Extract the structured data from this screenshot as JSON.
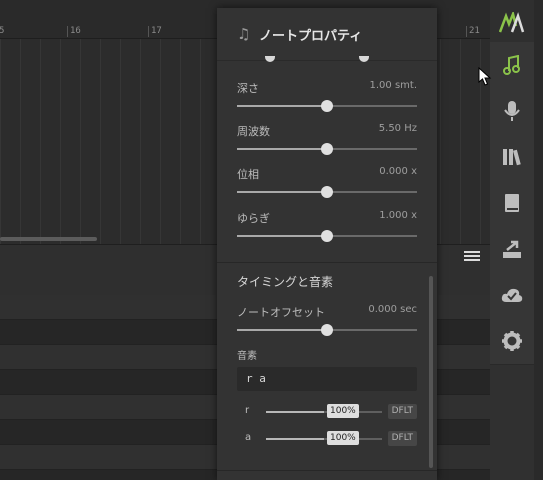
{
  "ruler": {
    "ticks": [
      "5",
      "16",
      "17",
      "21"
    ]
  },
  "panel": {
    "title": "ノートプロパティ",
    "params": [
      {
        "label": "深さ",
        "value": "1.00 smt.",
        "level": 0.5
      },
      {
        "label": "周波数",
        "value": "5.50 Hz",
        "level": 0.5
      },
      {
        "label": "位相",
        "value": "0.000 x",
        "level": 0.5
      },
      {
        "label": "ゆらぎ",
        "value": "1.000 x",
        "level": 0.5
      }
    ],
    "timing_section": "タイミングと音素",
    "offset": {
      "label": "ノートオフセット",
      "value": "0.000 sec",
      "level": 0.5
    },
    "phonemes_label": "音素",
    "phonemes_text": "r a",
    "phoneme_rows": [
      {
        "ph": "r",
        "pct": "100%",
        "level": 0.5,
        "button": "DFLT"
      },
      {
        "ph": "a",
        "pct": "100%",
        "level": 0.5,
        "button": "DFLT"
      }
    ]
  },
  "toolbar": {
    "items": [
      "logo-icon",
      "note-icon",
      "microphone-icon",
      "library-icon",
      "book-icon",
      "export-icon",
      "cloud-icon",
      "settings-icon"
    ],
    "accent": "#8bc34a"
  }
}
